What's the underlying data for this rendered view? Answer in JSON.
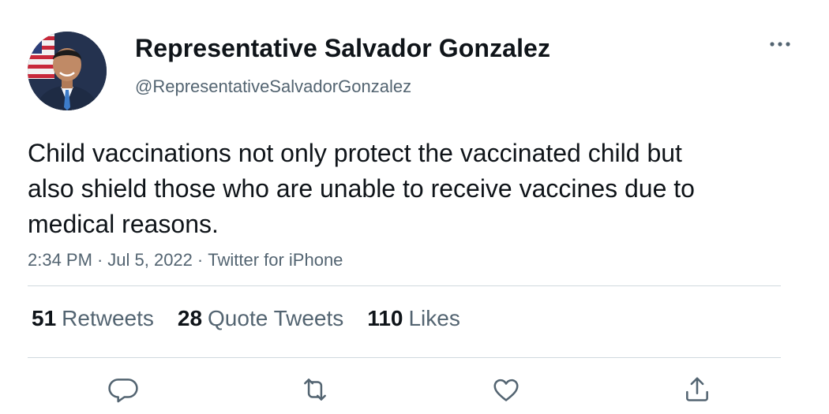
{
  "tweet": {
    "display_name": "Representative Salvador Gonzalez",
    "handle": "@RepresentativeSalvadorGonzalez",
    "text": "Child vaccinations not only protect the vaccinated child but also shield those who are unable to receive vaccines due to medical reasons.",
    "time": "2:34 PM",
    "date": "Jul 5, 2022",
    "source": "Twitter for iPhone",
    "separator": "·"
  },
  "stats": {
    "retweets_count": "51",
    "retweets_label": "Retweets",
    "quotes_count": "28",
    "quotes_label": "Quote Tweets",
    "likes_count": "110",
    "likes_label": "Likes"
  },
  "icons": {
    "more": "more-icon",
    "reply": "reply-icon",
    "retweet": "retweet-icon",
    "like": "heart-icon",
    "share": "share-icon"
  },
  "colors": {
    "primary_text": "#0f1419",
    "secondary_text": "#536471",
    "divider": "#cfd9de"
  }
}
